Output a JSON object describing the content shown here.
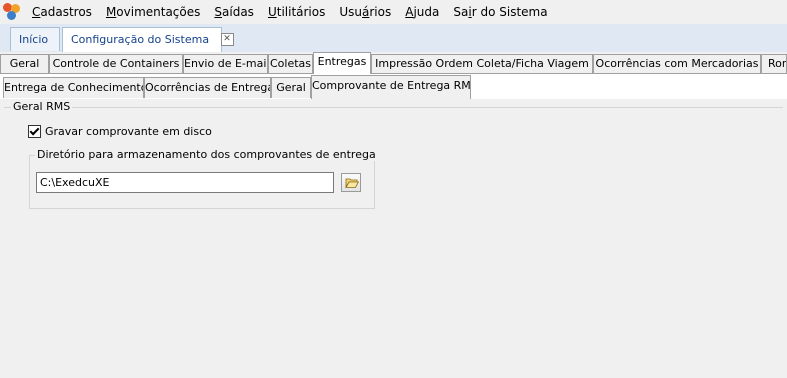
{
  "menu": [
    {
      "label_u": "C",
      "label_rest": "adastros"
    },
    {
      "label_u": "M",
      "label_rest": "ovimentações"
    },
    {
      "label_u": "S",
      "label_rest": "aídas"
    },
    {
      "label_u": "U",
      "label_rest": "tilitários"
    },
    {
      "label_pre": "Usu",
      "label_u": "á",
      "label_rest": "rios"
    },
    {
      "label_u": "A",
      "label_rest": "juda"
    },
    {
      "label_pre": "Sa",
      "label_u": "i",
      "label_rest": "r do Sistema"
    }
  ],
  "doc_tabs": [
    {
      "label": "Início"
    },
    {
      "label": "Configuração do Sistema",
      "close": "☒"
    }
  ],
  "tabs_level1": [
    "Geral",
    "Controle de Containers",
    "Envio de E-mail",
    "Coletas",
    "Entregas",
    "Impressão Ordem Coleta/Ficha Viagem",
    "Ocorrências com Mercadorias",
    "Rom"
  ],
  "tabs_level2": [
    "Entrega de Conhecimentos",
    "Ocorrências de Entrega",
    "Geral",
    "Comprovante de Entrega RMS"
  ],
  "content": {
    "group_title": "Geral RMS",
    "checkbox_label": "Gravar comprovante em disco",
    "checkbox_checked": true,
    "dir_group_title": "Diretório para armazenamento dos comprovantes de entrega",
    "dir_value": "C:\\ExedcuXE"
  },
  "colors": {
    "doc_tab_text": "#15428b",
    "window_bg": "#f0f0f0",
    "border": "#a0a0a0"
  },
  "icons": {
    "app": "app-logo-icon",
    "folder": "folder-open-icon"
  }
}
